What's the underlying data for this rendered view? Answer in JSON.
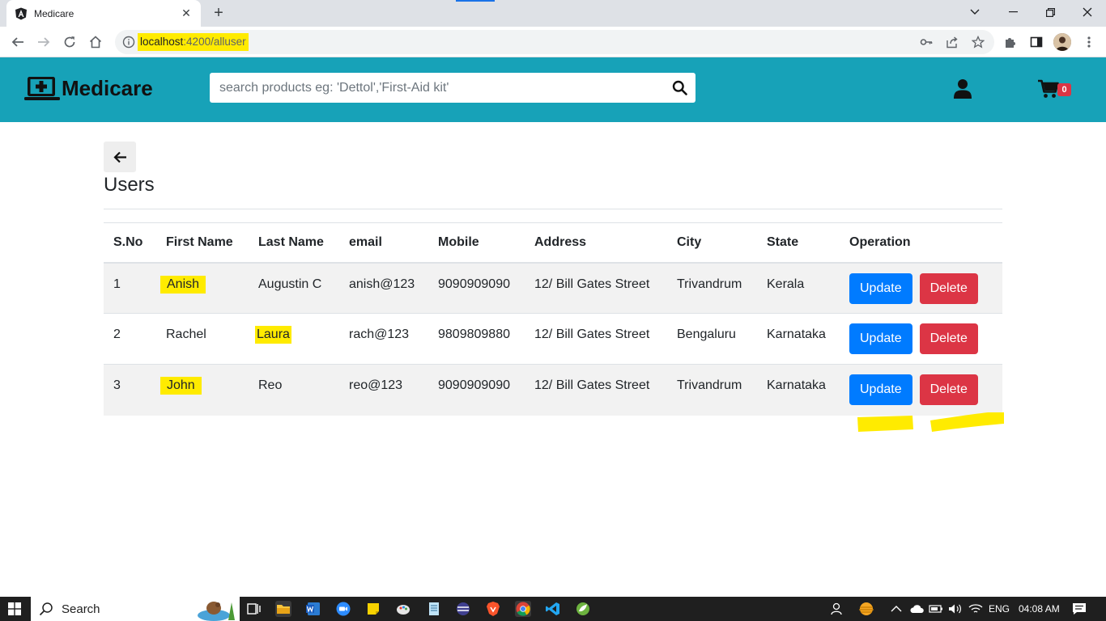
{
  "browser": {
    "tab_title": "Medicare",
    "tab_close_glyph": "✕",
    "new_tab_glyph": "+",
    "url_host": "localhost",
    "url_rest": ":4200/alluser",
    "window_controls": [
      "chevron-down-icon",
      "minimize-icon",
      "restore-icon",
      "close-icon"
    ],
    "accent_color": "#1a73e8"
  },
  "site": {
    "brand": "Medicare",
    "header_color": "#17a2b8",
    "search_placeholder": "search products eg: 'Dettol','First-Aid kit'",
    "search_value": "",
    "cart_count": "0"
  },
  "page": {
    "back_glyph": "←",
    "title": "Users"
  },
  "table": {
    "headers": [
      "S.No",
      "First Name",
      "Last Name",
      "email",
      "Mobile",
      "Address",
      "City",
      "State",
      "Operation"
    ],
    "rows": [
      {
        "sno": "1",
        "first_name": "Anish",
        "last_name": "Augustin C",
        "email": "anish@123",
        "mobile": "9090909090",
        "address": "12/ Bill Gates Street",
        "city": "Trivandrum",
        "state": "Kerala",
        "update_label": "Update",
        "delete_label": "Delete"
      },
      {
        "sno": "2",
        "first_name": "Rachel",
        "last_name": "Laura",
        "email": "rach@123",
        "mobile": "9809809880",
        "address": "12/ Bill Gates Street",
        "city": "Bengaluru",
        "state": "Karnataka",
        "update_label": "Update",
        "delete_label": "Delete"
      },
      {
        "sno": "3",
        "first_name": "John",
        "last_name": "Reo",
        "email": "reo@123",
        "mobile": "9090909090",
        "address": "12/ Bill Gates Street",
        "city": "Trivandrum",
        "state": "Karnataka",
        "update_label": "Update",
        "delete_label": "Delete"
      }
    ],
    "primary_color": "#007bff",
    "danger_color": "#dc3545",
    "highlight_color": "#ffeb00"
  },
  "taskbar": {
    "search_label": "Search",
    "language": "ENG",
    "time": "04:08 AM"
  }
}
